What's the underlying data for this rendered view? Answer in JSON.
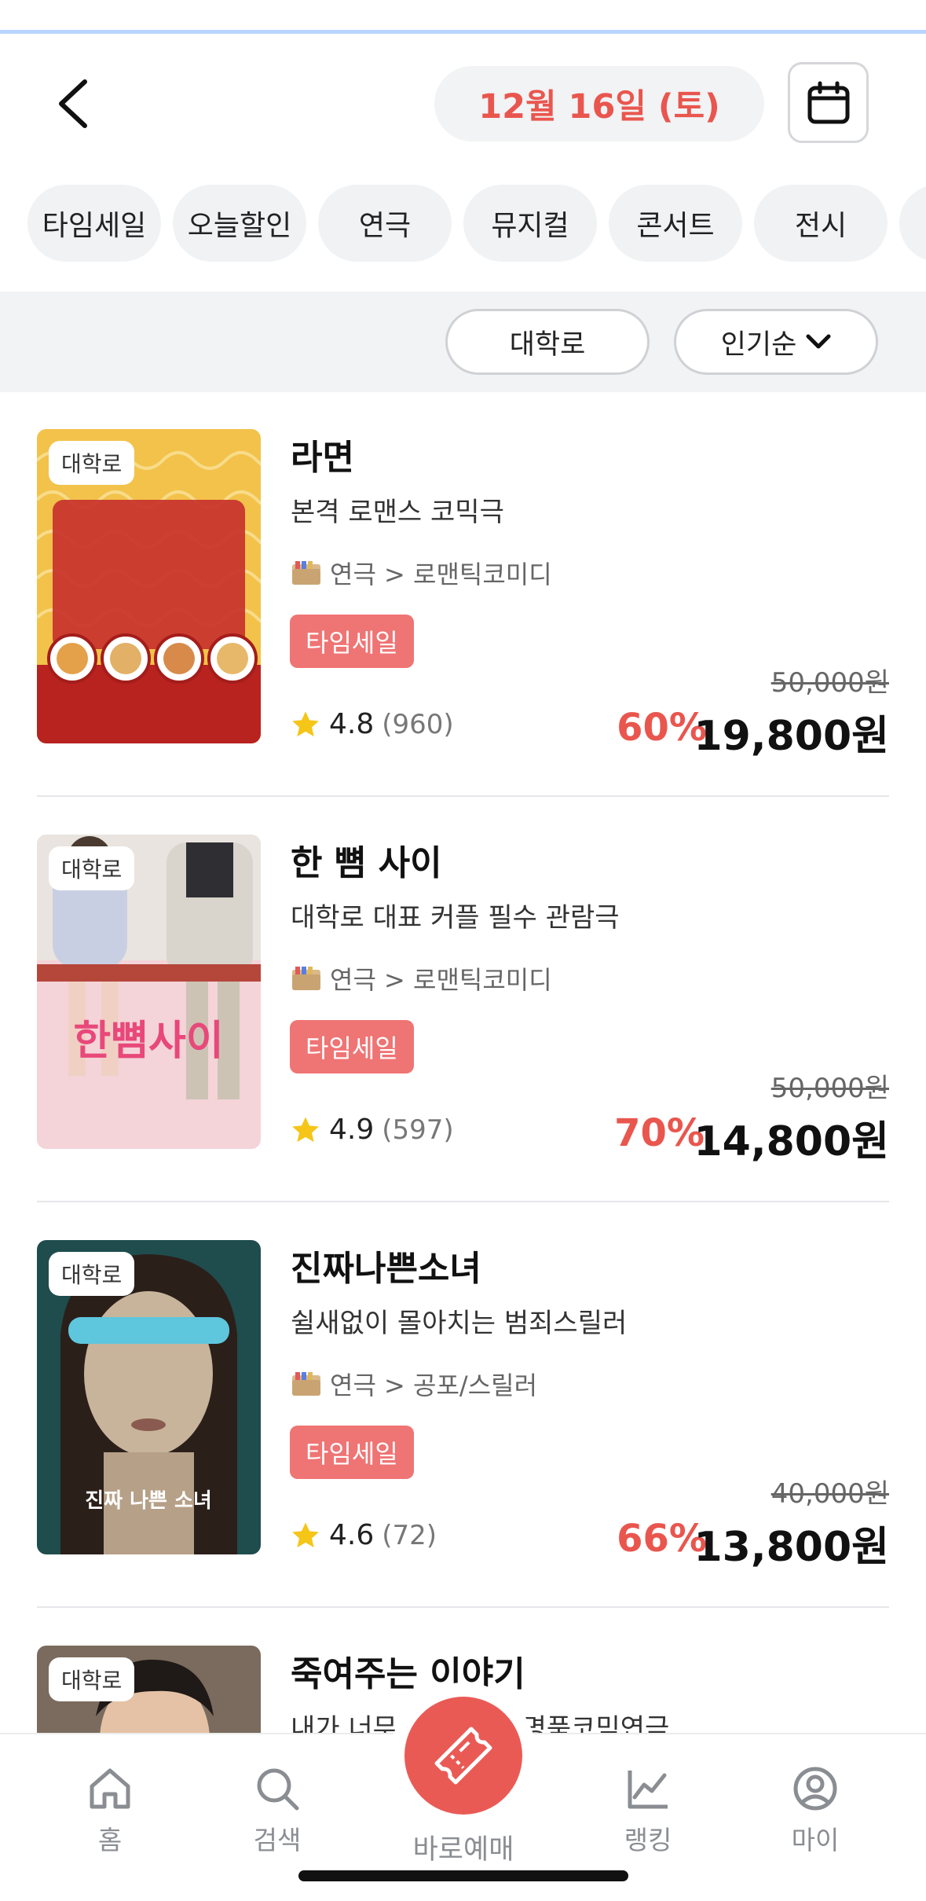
{
  "header": {
    "date": "12월 16일 (토)"
  },
  "categories": [
    "타임세일",
    "오늘할인",
    "연극",
    "뮤지컬",
    "콘서트",
    "전시"
  ],
  "filters": {
    "region": "대학로",
    "sort": "인기순"
  },
  "items": [
    {
      "location": "대학로",
      "title": "라면",
      "subtitle": "본격 로맨스 코믹극",
      "genre": "연극 > 로맨틱코미디",
      "badge": "타임세일",
      "rating": "4.8",
      "review_count": "(960)",
      "original_price": "50,000원",
      "discount": "60%",
      "price": "19,800원"
    },
    {
      "location": "대학로",
      "title": "한 뼘 사이",
      "subtitle": "대학로 대표 커플 필수 관람극",
      "genre": "연극 > 로맨틱코미디",
      "badge": "타임세일",
      "rating": "4.9",
      "review_count": "(597)",
      "original_price": "50,000원",
      "discount": "70%",
      "price": "14,800원"
    },
    {
      "location": "대학로",
      "title": "진짜나쁜소녀",
      "subtitle": "쉴새없이 몰아치는 범죄스릴러",
      "genre": "연극 > 공포/스릴러",
      "badge": "타임세일",
      "rating": "4.6",
      "review_count": "(72)",
      "original_price": "40,000원",
      "discount": "66%",
      "price": "13,800원"
    },
    {
      "location": "대학로",
      "title": "죽여주는 이야기",
      "subtitle": "내가 너무 ... 권하는 명품코믹연극"
    }
  ],
  "bottom_nav": {
    "home": "홈",
    "search": "검색",
    "quick_booking": "바로예매",
    "ranking": "랭킹",
    "my": "마이"
  },
  "colors": {
    "accent": "#e9564e",
    "badge": "#ef7474",
    "chip_bg": "#f1f2f4"
  }
}
